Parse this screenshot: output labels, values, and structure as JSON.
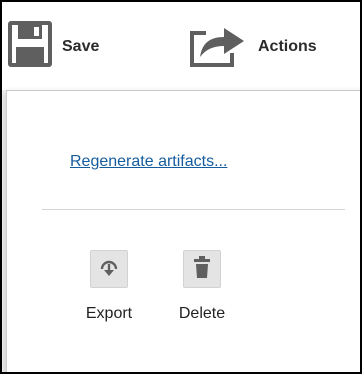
{
  "toolbar": {
    "save_label": "Save",
    "actions_label": "Actions"
  },
  "menu": {
    "regenerate_label": "Regenerate artifacts...",
    "export_label": "Export",
    "delete_label": "Delete"
  },
  "icons": {
    "save": "floppy-disk-icon",
    "actions": "share-arrow-icon",
    "export": "export-icon",
    "delete": "trash-icon"
  },
  "colors": {
    "link": "#145c9e",
    "icon_gray": "#5f5f5f",
    "button_bg": "#e4e4e4"
  }
}
